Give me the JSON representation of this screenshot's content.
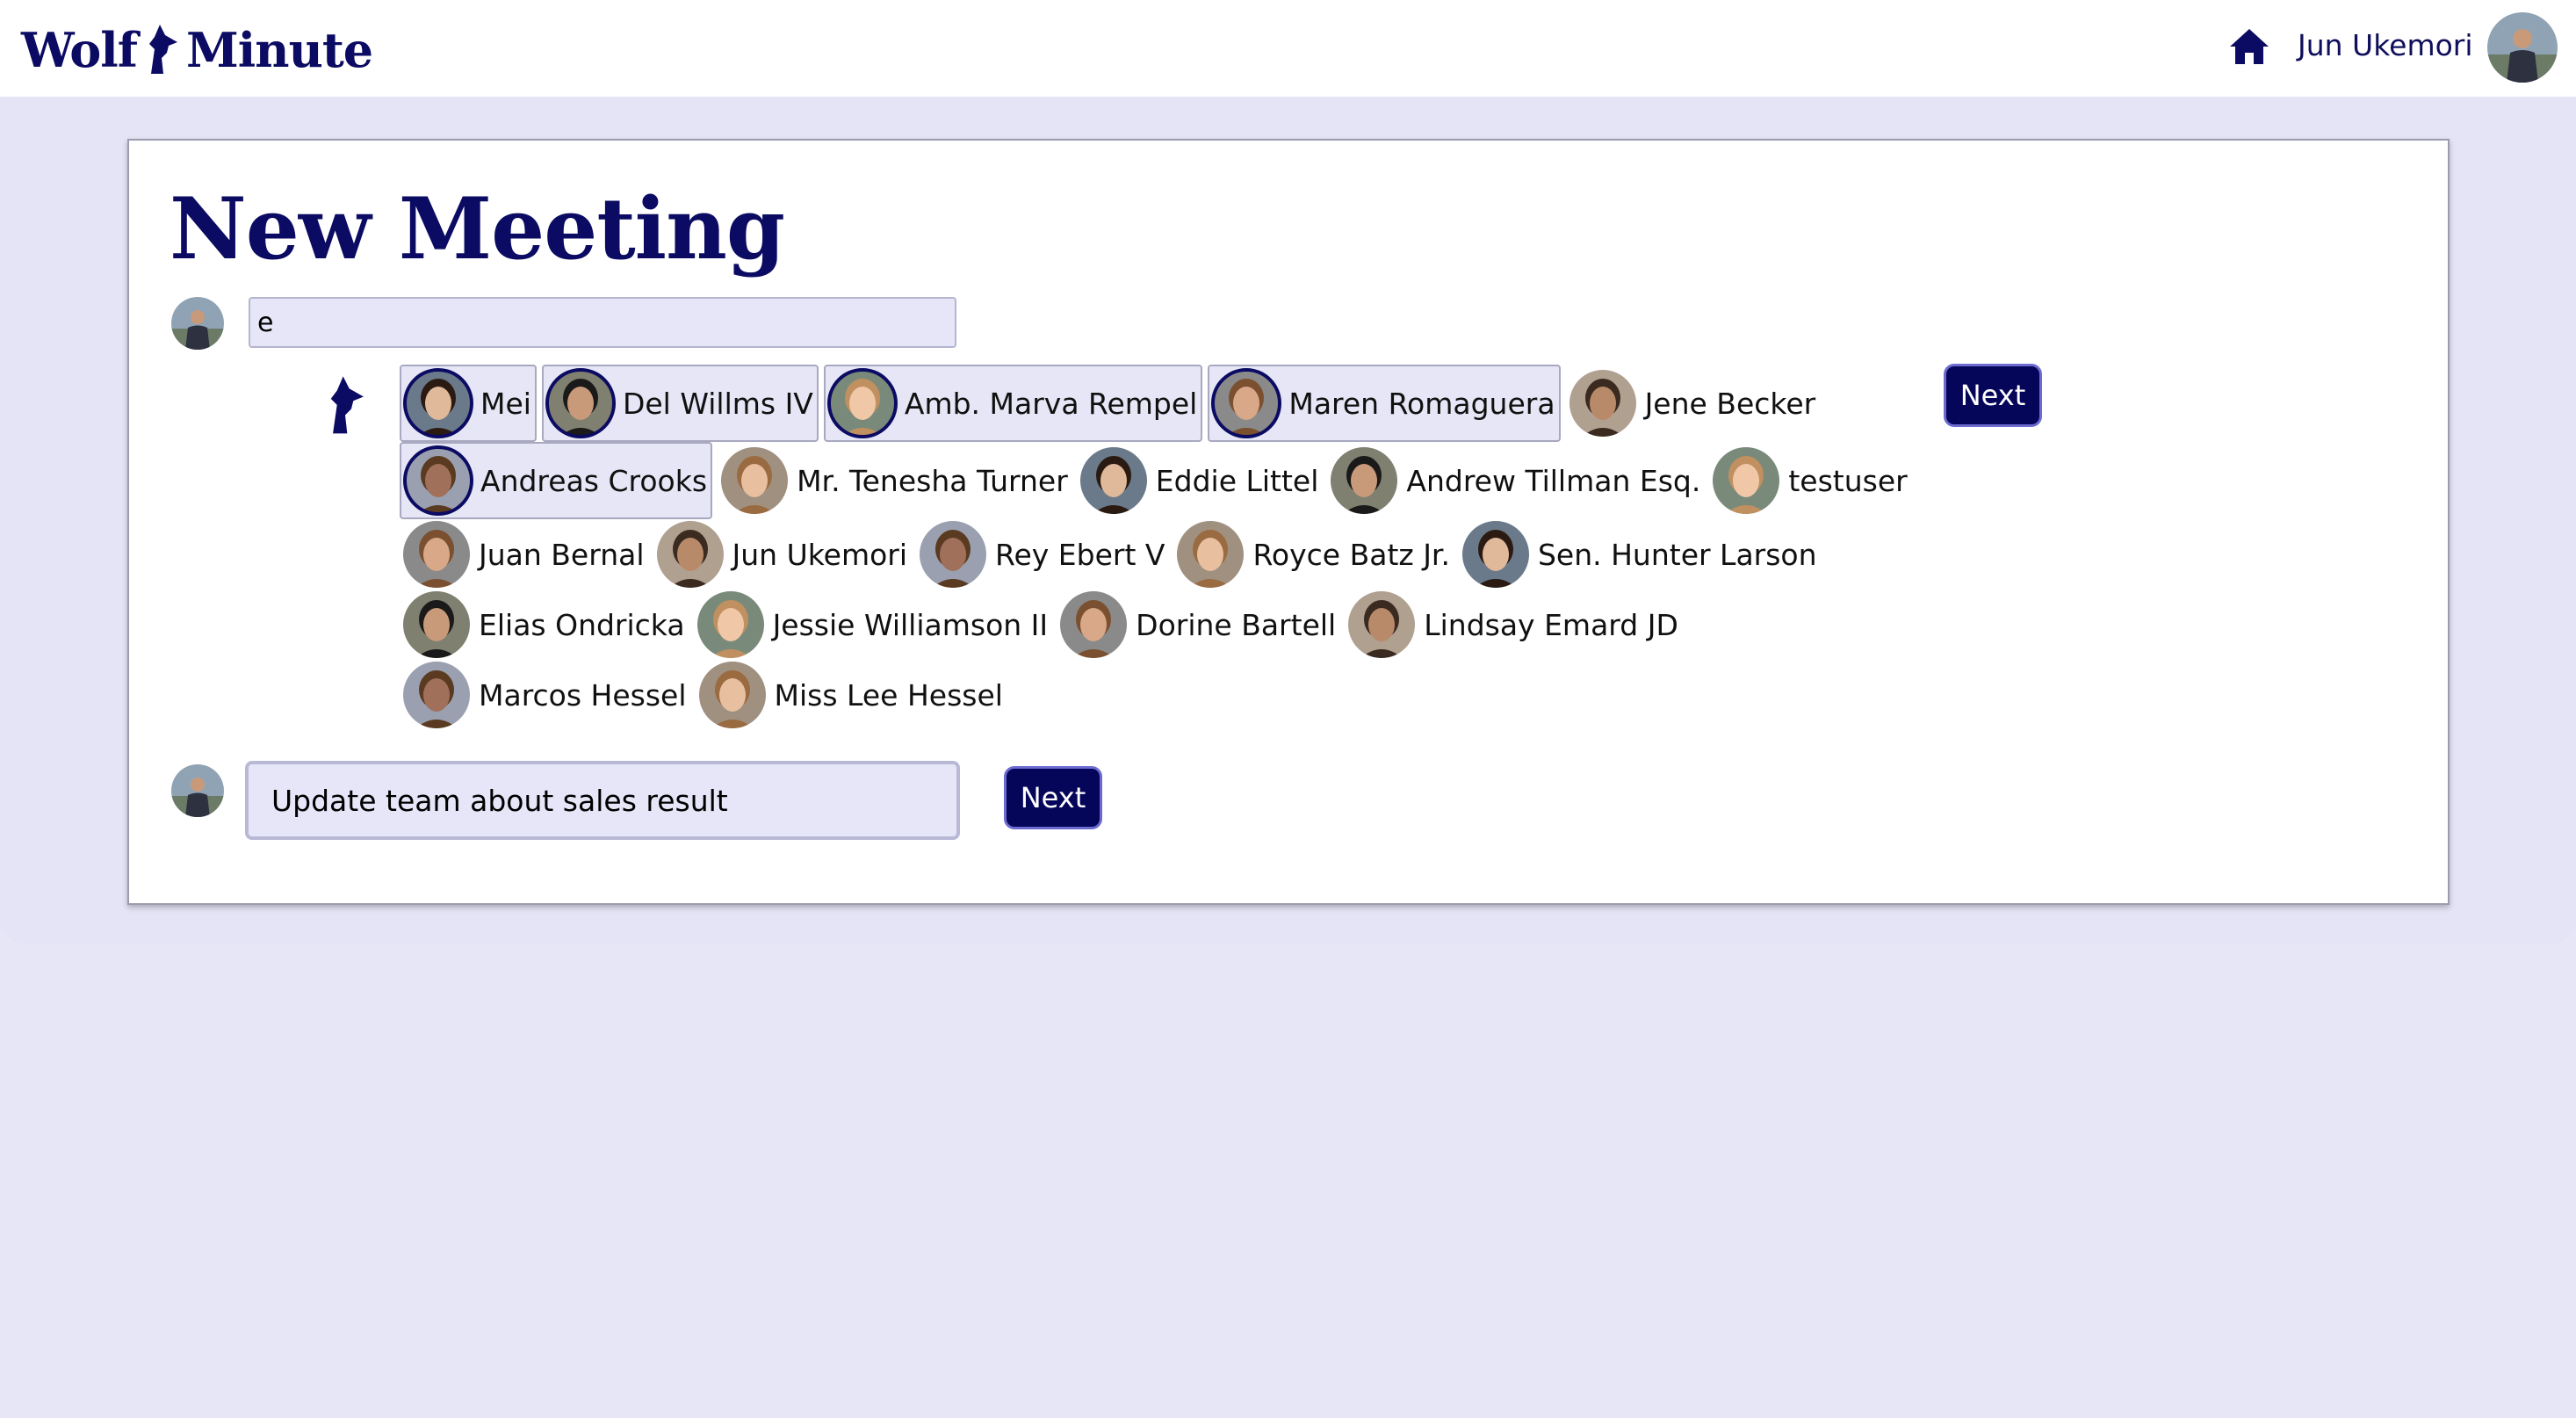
{
  "header": {
    "logo_left": "Wolf",
    "logo_right": "Minute",
    "home_icon": "home-icon",
    "user_name": "Jun Ukemori"
  },
  "page": {
    "title": "New Meeting"
  },
  "attendee_search": {
    "value": "e",
    "next_label": "Next"
  },
  "people": [
    {
      "name": "Mei",
      "selected": true
    },
    {
      "name": "Del Willms IV",
      "selected": true
    },
    {
      "name": "Amb. Marva Rempel",
      "selected": true
    },
    {
      "name": "Maren Romaguera",
      "selected": true
    },
    {
      "name": "Jene Becker",
      "selected": false
    },
    {
      "name": "Andreas Crooks",
      "selected": true
    },
    {
      "name": "Mr. Tenesha Turner",
      "selected": false
    },
    {
      "name": "Eddie Littel",
      "selected": false
    },
    {
      "name": "Andrew Tillman Esq.",
      "selected": false
    },
    {
      "name": "testuser",
      "selected": false
    },
    {
      "name": "Juan Bernal",
      "selected": false
    },
    {
      "name": "Jun Ukemori",
      "selected": false
    },
    {
      "name": "Rey Ebert V",
      "selected": false
    },
    {
      "name": "Royce Batz Jr.",
      "selected": false
    },
    {
      "name": "Sen. Hunter Larson",
      "selected": false
    },
    {
      "name": "Elias Ondricka",
      "selected": false
    },
    {
      "name": "Jessie Williamson II",
      "selected": false
    },
    {
      "name": "Dorine Bartell",
      "selected": false
    },
    {
      "name": "Lindsay Emard JD",
      "selected": false
    },
    {
      "name": "Marcos Hessel",
      "selected": false
    },
    {
      "name": "Miss Lee Hessel",
      "selected": false
    }
  ],
  "meeting_title": {
    "value": "Update team about sales result",
    "next_label": "Next"
  },
  "colors": {
    "brand": "#0b0b63",
    "button": "#05055a",
    "field": "#e6e6f8",
    "background": "#e6e6f7"
  }
}
